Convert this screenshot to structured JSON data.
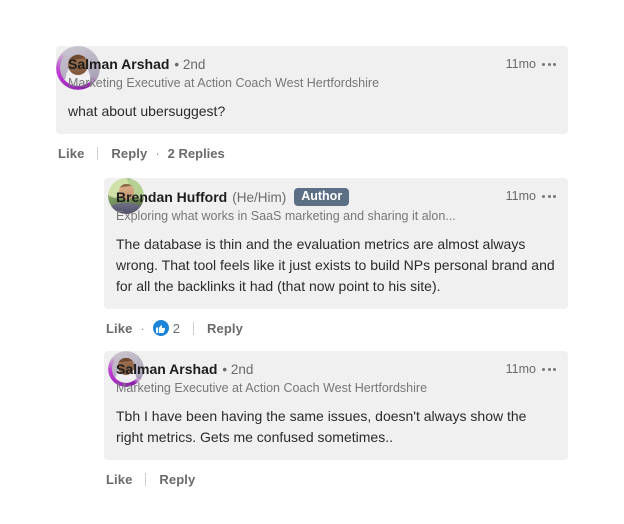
{
  "colors": {
    "bubble_bg": "#f0f0f0",
    "page_bg": "#ffffff",
    "author_badge_bg": "#5c6f84",
    "reaction_blue": "#1b84d8",
    "primary_text": "#2b2b2b",
    "muted_text": "#6a6a6a"
  },
  "thread": {
    "comments": [
      {
        "id": "comment-1",
        "level": 0,
        "avatar_name": "avatar-salman-arshad",
        "author": "Salman Arshad",
        "degree": "• 2nd",
        "pronouns": "",
        "badge": "",
        "headline": "Marketing Executive at Action Coach West Hertfordshire",
        "timestamp": "11mo",
        "menu_icon": "more-options-icon",
        "body": "what about ubersuggest?",
        "actions": {
          "like_label": "Like",
          "reply_label": "Reply",
          "replies_label": "2 Replies",
          "reaction_icon": "",
          "reaction_count": ""
        }
      },
      {
        "id": "comment-2",
        "level": 1,
        "avatar_name": "avatar-brendan-hufford",
        "author": "Brendan Hufford",
        "degree": "",
        "pronouns": "(He/Him)",
        "badge": "Author",
        "headline": "Exploring what works in SaaS marketing and sharing it alon...",
        "timestamp": "11mo",
        "menu_icon": "more-options-icon",
        "body": "The database is thin and the evaluation metrics are almost always wrong. That tool feels like it just exists to build NPs personal brand and for all the backlinks it had (that now point to his site).",
        "actions": {
          "like_label": "Like",
          "reply_label": "Reply",
          "replies_label": "",
          "reaction_icon": "thumbs-up-reaction-icon",
          "reaction_count": "2"
        }
      },
      {
        "id": "comment-3",
        "level": 1,
        "avatar_name": "avatar-salman-arshad",
        "author": "Salman Arshad",
        "degree": "• 2nd",
        "pronouns": "",
        "badge": "",
        "headline": "Marketing Executive at Action Coach West Hertfordshire",
        "timestamp": "11mo",
        "menu_icon": "more-options-icon",
        "body": "Tbh I have been having the same issues, doesn't always show the right metrics. Gets me confused sometimes..",
        "actions": {
          "like_label": "Like",
          "reply_label": "Reply",
          "replies_label": "",
          "reaction_icon": "",
          "reaction_count": ""
        }
      }
    ]
  }
}
